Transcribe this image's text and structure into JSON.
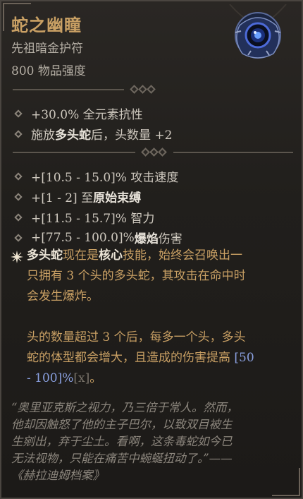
{
  "item": {
    "name": "蛇之幽瞳",
    "type": "先祖暗金护符",
    "power": "800 物品强度",
    "icon": "serpent-eye-amulet-icon"
  },
  "implicits": [
    {
      "pre": "+30.0% 全元素抗性",
      "bold": "",
      "post": ""
    },
    {
      "pre": "施放",
      "bold": "多头蛇",
      "post": "后，头数量 +2"
    }
  ],
  "affixes": [
    {
      "pre": "+[10.5 - 15.0]% 攻击速度",
      "bold": "",
      "post": ""
    },
    {
      "pre": "+[1 - 2] 至",
      "bold": "原始束缚",
      "post": ""
    },
    {
      "pre": "+[11.5 - 15.7]% 智力",
      "bold": "",
      "post": ""
    },
    {
      "pre": "+[77.5 - 100.0]% ",
      "bold": "爆焰",
      "post": "伤害"
    }
  ],
  "unique_power": {
    "line1_b1": "多头蛇",
    "line1_t1": "现在是",
    "line1_b2": "核心",
    "line1_t2": "技能，始终会召唤出一",
    "line2": "只拥有 3 个头的多头蛇，其攻击在命中时",
    "line3": "会发生爆炸。",
    "para2_line1": "头的数量超过 3 个后，每多一个头，多头",
    "para2_line2a": "蛇的体型都会增大，且造成的伤害提高 ",
    "para2_num_a": "[50",
    "para2_num_b": "- 100]%",
    "para2_x": "[x]",
    "para2_end": "。"
  },
  "flavor": {
    "l1": "“奥里亚克斯之视力，乃三倍于常人。然而，",
    "l2": "他却因触怒了他的主子巴尔，以致双目被生",
    "l3": "生剜出，弃于尘土。看啊，这条毒蛇如今已",
    "l4": "无法视物，只能在痛苦中蜿蜒扭动了。”——",
    "l5": "《赫拉迪姆档案》"
  },
  "colors": {
    "title": "#c9a064",
    "aspect_text": "#c9a064",
    "range": "#8aa0e0",
    "bg": "#23211e"
  }
}
